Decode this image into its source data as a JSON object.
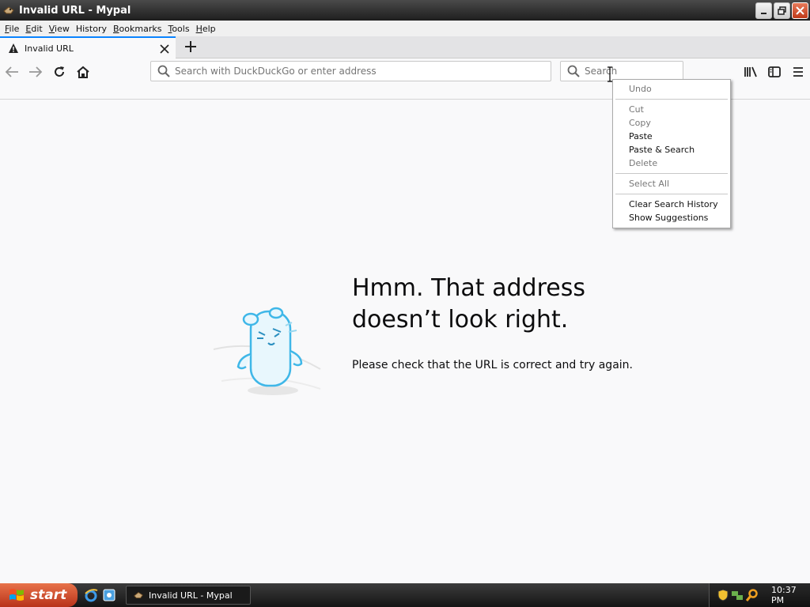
{
  "window": {
    "title": "Invalid URL - Mypal"
  },
  "menubar": {
    "items": [
      {
        "label": "File",
        "accel": "F",
        "rest": "ile"
      },
      {
        "label": "Edit",
        "accel": "E",
        "rest": "dit"
      },
      {
        "label": "View",
        "accel": "V",
        "rest": "iew"
      },
      {
        "label": "History",
        "accel": "",
        "rest": "History"
      },
      {
        "label": "Bookmarks",
        "accel": "B",
        "rest": "ookmarks"
      },
      {
        "label": "Tools",
        "accel": "T",
        "rest": "ools"
      },
      {
        "label": "Help",
        "accel": "H",
        "rest": "elp"
      }
    ]
  },
  "tab": {
    "title": "Invalid URL"
  },
  "urlbar": {
    "placeholder": "Search with DuckDuckGo or enter address"
  },
  "searchbar": {
    "placeholder": "Search"
  },
  "content": {
    "title": "Hmm. That address doesn’t look right.",
    "message": "Please check that the URL is correct and try again."
  },
  "context_menu": {
    "items": [
      {
        "label": "Undo",
        "disabled": true
      },
      {
        "label": "Cut",
        "disabled": true
      },
      {
        "label": "Copy",
        "disabled": true
      },
      {
        "label": "Paste",
        "disabled": false
      },
      {
        "label": "Paste & Search",
        "disabled": false
      },
      {
        "label": "Delete",
        "disabled": true
      },
      {
        "label": "Select All",
        "disabled": true
      },
      {
        "label": "Clear Search History",
        "disabled": false
      },
      {
        "label": "Show Suggestions",
        "disabled": false
      }
    ]
  },
  "taskbar": {
    "start_label": "start",
    "task_title": "Invalid URL - Mypal",
    "clock": "10:37 PM"
  },
  "colors": {
    "accent": "#0a84ff",
    "titlebar": "#2b2b2b",
    "start": "#c8502a"
  }
}
